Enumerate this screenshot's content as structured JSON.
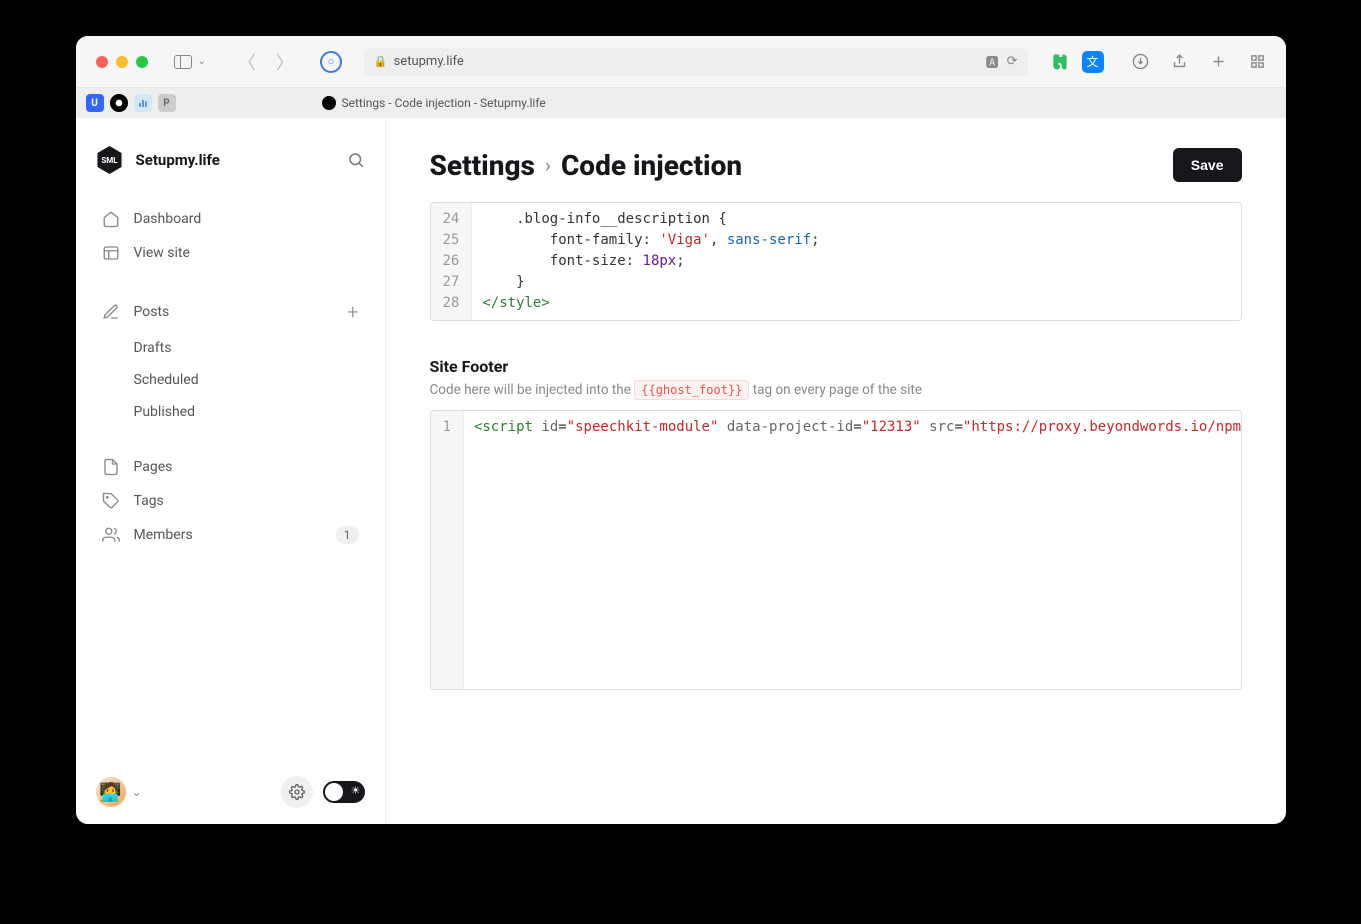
{
  "browser": {
    "url": "setupmy.life",
    "tab_title": "Settings - Code injection - Setupmy.life"
  },
  "site": {
    "name": "Setupmy.life",
    "logo_text": "SML"
  },
  "nav": {
    "dashboard": "Dashboard",
    "view_site": "View site",
    "posts": "Posts",
    "drafts": "Drafts",
    "scheduled": "Scheduled",
    "published": "Published",
    "pages": "Pages",
    "tags": "Tags",
    "members": "Members",
    "members_count": "1"
  },
  "breadcrumb": {
    "parent": "Settings",
    "current": "Code injection"
  },
  "buttons": {
    "save": "Save"
  },
  "header_editor": {
    "lines": [
      {
        "num": "24",
        "tokens": [
          {
            "t": "    .blog-info__description {",
            "c": ""
          }
        ]
      },
      {
        "num": "25",
        "tokens": [
          {
            "t": "        font-family",
            "c": "prop"
          },
          {
            "t": ": ",
            "c": ""
          },
          {
            "t": "'Viga'",
            "c": "str2"
          },
          {
            "t": ", ",
            "c": ""
          },
          {
            "t": "sans-serif",
            "c": "val"
          },
          {
            "t": ";",
            "c": ""
          }
        ]
      },
      {
        "num": "26",
        "tokens": [
          {
            "t": "        font-size",
            "c": "prop"
          },
          {
            "t": ": ",
            "c": ""
          },
          {
            "t": "18px",
            "c": "num"
          },
          {
            "t": ";",
            "c": ""
          }
        ]
      },
      {
        "num": "27",
        "tokens": [
          {
            "t": "    }",
            "c": ""
          }
        ]
      },
      {
        "num": "28",
        "tokens": [
          {
            "t": "</style>",
            "c": "tag"
          }
        ]
      }
    ]
  },
  "footer_section": {
    "title": "Site Footer",
    "desc_pre": "Code here will be injected into the ",
    "desc_tag": "{{ghost_foot}}",
    "desc_post": " tag on every page of the site"
  },
  "footer_editor": {
    "lines": [
      {
        "num": "1",
        "tokens": [
          {
            "t": "<script",
            "c": "tag"
          },
          {
            "t": " ",
            "c": ""
          },
          {
            "t": "id",
            "c": "attr"
          },
          {
            "t": "=",
            "c": ""
          },
          {
            "t": "\"speechkit-module\"",
            "c": "str2"
          },
          {
            "t": " ",
            "c": ""
          },
          {
            "t": "data-project-id",
            "c": "attr"
          },
          {
            "t": "=",
            "c": ""
          },
          {
            "t": "\"12313\"",
            "c": "str2"
          },
          {
            "t": " ",
            "c": ""
          },
          {
            "t": "src",
            "c": "attr"
          },
          {
            "t": "=",
            "c": ""
          },
          {
            "t": "\"https://proxy.beyondwords.io/npm/@",
            "c": "str2"
          }
        ]
      }
    ]
  }
}
